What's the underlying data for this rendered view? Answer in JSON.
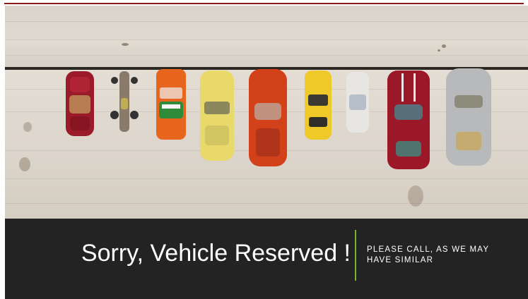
{
  "banner": {
    "title": "Sorry, Vehicle Reserved !",
    "subtitle": "PLEASE CALL, AS WE MAY HAVE SIMILAR"
  },
  "photo": {
    "subject": "toy-cars-on-wood",
    "cars": [
      {
        "name": "red-car",
        "color": "#9b1b2a"
      },
      {
        "name": "race-car",
        "color": "#8a7a6a"
      },
      {
        "name": "orange-car",
        "color": "#e8651e"
      },
      {
        "name": "yellow-car",
        "color": "#e8d96a"
      },
      {
        "name": "orange-red-car",
        "color": "#d2411a"
      },
      {
        "name": "yellow-sports-car",
        "color": "#eec928"
      },
      {
        "name": "white-car",
        "color": "#e8e6e2"
      },
      {
        "name": "maroon-car",
        "color": "#9a1828"
      },
      {
        "name": "silver-car",
        "color": "#b7b9bb"
      }
    ]
  },
  "colors": {
    "banner_bg": "#232323",
    "divider": "#76b82a",
    "top_accent": "#8e1a1a"
  }
}
